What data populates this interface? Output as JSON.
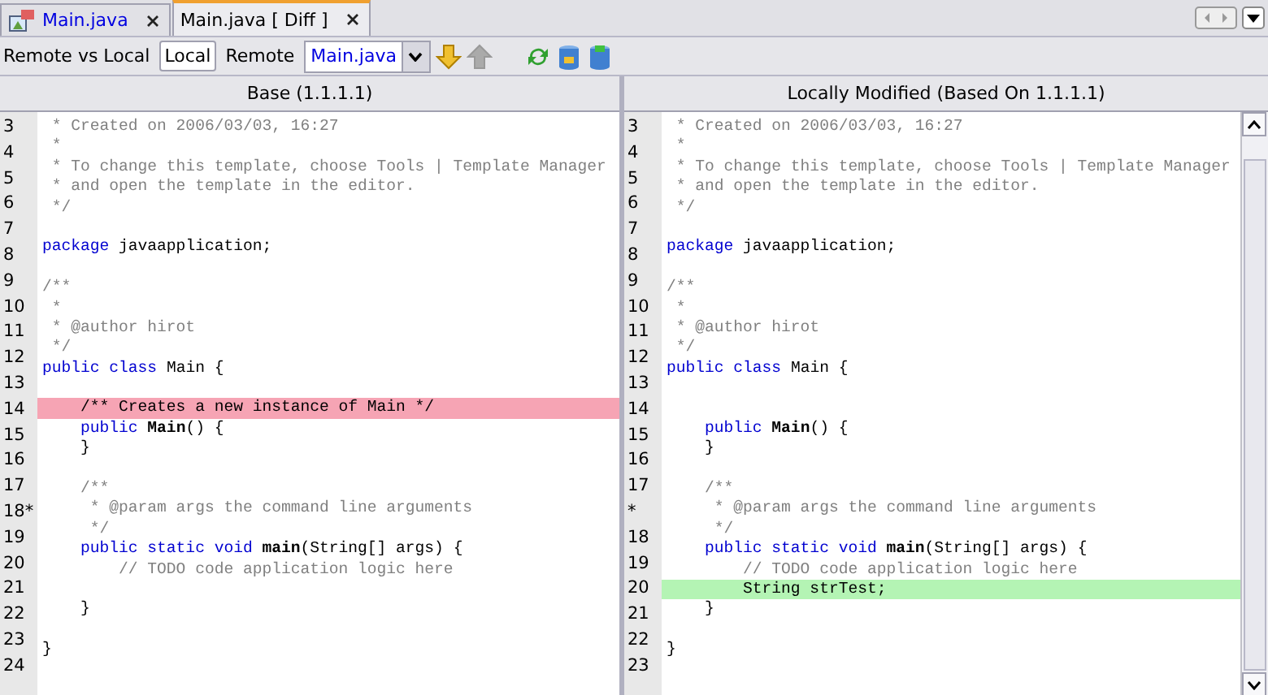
{
  "tabs": [
    {
      "label": "Main.java",
      "selected": false
    },
    {
      "label": "Main.java [ Diff ]",
      "selected": true
    }
  ],
  "toolbar": {
    "label": "Remote vs Local",
    "modes": [
      {
        "label": "Local",
        "selected": true
      },
      {
        "label": "Remote",
        "selected": false
      }
    ],
    "file_combo": {
      "value": "Main.java"
    },
    "next_diff": {
      "disabled": false
    },
    "prev_diff": {
      "disabled": true
    }
  },
  "panes": [
    {
      "title": "Base (1.1.1.1)",
      "gutter": [
        "3",
        "4",
        "5",
        "6",
        "7",
        "8",
        "9",
        "10",
        "11",
        "12",
        "13",
        "14",
        "15",
        "16",
        "17",
        "18*",
        "19",
        "20",
        "21",
        "22",
        "23",
        "24"
      ],
      "lines": [
        {
          "kind": "context",
          "segments": [
            {
              "kind": "comment",
              "text": " * Created on 2006/03/03, 16:27"
            }
          ]
        },
        {
          "kind": "context",
          "segments": [
            {
              "kind": "comment",
              "text": " *"
            }
          ]
        },
        {
          "kind": "context",
          "segments": [
            {
              "kind": "comment",
              "text": " * To change this template, choose Tools | Template Manager"
            }
          ]
        },
        {
          "kind": "context",
          "segments": [
            {
              "kind": "comment",
              "text": " * and open the template in the editor."
            }
          ]
        },
        {
          "kind": "context",
          "segments": [
            {
              "kind": "comment",
              "text": " */"
            }
          ]
        },
        {
          "kind": "blank"
        },
        {
          "kind": "context",
          "segments": [
            {
              "kind": "keyword",
              "text": "package"
            },
            {
              "kind": "plain",
              "text": " javaapplication;"
            }
          ]
        },
        {
          "kind": "blank"
        },
        {
          "kind": "context",
          "segments": [
            {
              "kind": "comment",
              "text": "/**"
            }
          ]
        },
        {
          "kind": "context",
          "segments": [
            {
              "kind": "comment",
              "text": " *"
            }
          ]
        },
        {
          "kind": "context",
          "segments": [
            {
              "kind": "comment",
              "text": " * @author hirot"
            }
          ]
        },
        {
          "kind": "context",
          "segments": [
            {
              "kind": "comment",
              "text": " */"
            }
          ]
        },
        {
          "kind": "context",
          "segments": [
            {
              "kind": "keyword",
              "text": "public class"
            },
            {
              "kind": "plain",
              "text": " Main {"
            }
          ]
        },
        {
          "kind": "blank"
        },
        {
          "kind": "deleted",
          "segments": [
            {
              "kind": "plain",
              "text": "    /** Creates a new instance of Main */"
            }
          ]
        },
        {
          "kind": "context",
          "segments": [
            {
              "kind": "keyword",
              "text": "    public"
            },
            {
              "kind": "method",
              "text": " Main"
            },
            {
              "kind": "plain",
              "text": "() {"
            }
          ]
        },
        {
          "kind": "context",
          "segments": [
            {
              "kind": "plain",
              "text": "    }"
            }
          ]
        },
        {
          "kind": "blank"
        },
        {
          "kind": "context",
          "segments": [
            {
              "kind": "comment",
              "text": "    /**"
            }
          ]
        },
        {
          "kind": "context",
          "segments": [
            {
              "kind": "comment",
              "text": "     * @param args the command line arguments"
            }
          ]
        },
        {
          "kind": "context",
          "segments": [
            {
              "kind": "comment",
              "text": "     */"
            }
          ]
        },
        {
          "kind": "context",
          "segments": [
            {
              "kind": "keyword",
              "text": "    public static void"
            },
            {
              "kind": "method",
              "text": " main"
            },
            {
              "kind": "plain",
              "text": "(String[] args) {"
            }
          ]
        },
        {
          "kind": "context",
          "segments": [
            {
              "kind": "comment",
              "text": "        // TODO code application logic here"
            }
          ]
        },
        {
          "kind": "blank"
        },
        {
          "kind": "context",
          "segments": [
            {
              "kind": "plain",
              "text": "    }"
            }
          ]
        },
        {
          "kind": "blank"
        },
        {
          "kind": "context",
          "segments": [
            {
              "kind": "plain",
              "text": "}"
            }
          ]
        },
        {
          "kind": "blank"
        }
      ]
    },
    {
      "title": "Locally Modified (Based On 1.1.1.1)",
      "gutter": [
        "3",
        "4",
        "5",
        "6",
        "7",
        "8",
        "9",
        "10",
        "11",
        "12",
        "13",
        "14",
        "15",
        "16",
        "17",
        "*",
        "18",
        "19",
        "20",
        "21",
        "22",
        "23"
      ],
      "lines": [
        {
          "kind": "context",
          "segments": [
            {
              "kind": "comment",
              "text": " * Created on 2006/03/03, 16:27"
            }
          ]
        },
        {
          "kind": "context",
          "segments": [
            {
              "kind": "comment",
              "text": " *"
            }
          ]
        },
        {
          "kind": "context",
          "segments": [
            {
              "kind": "comment",
              "text": " * To change this template, choose Tools | Template Manager"
            }
          ]
        },
        {
          "kind": "context",
          "segments": [
            {
              "kind": "comment",
              "text": " * and open the template in the editor."
            }
          ]
        },
        {
          "kind": "context",
          "segments": [
            {
              "kind": "comment",
              "text": " */"
            }
          ]
        },
        {
          "kind": "blank"
        },
        {
          "kind": "context",
          "segments": [
            {
              "kind": "keyword",
              "text": "package"
            },
            {
              "kind": "plain",
              "text": " javaapplication;"
            }
          ]
        },
        {
          "kind": "blank"
        },
        {
          "kind": "context",
          "segments": [
            {
              "kind": "comment",
              "text": "/**"
            }
          ]
        },
        {
          "kind": "context",
          "segments": [
            {
              "kind": "comment",
              "text": " *"
            }
          ]
        },
        {
          "kind": "context",
          "segments": [
            {
              "kind": "comment",
              "text": " * @author hirot"
            }
          ]
        },
        {
          "kind": "context",
          "segments": [
            {
              "kind": "comment",
              "text": " */"
            }
          ]
        },
        {
          "kind": "context",
          "segments": [
            {
              "kind": "keyword",
              "text": "public class"
            },
            {
              "kind": "plain",
              "text": " Main {"
            }
          ]
        },
        {
          "kind": "blank"
        },
        {
          "kind": "blank"
        },
        {
          "kind": "context",
          "segments": [
            {
              "kind": "keyword",
              "text": "    public"
            },
            {
              "kind": "method",
              "text": " Main"
            },
            {
              "kind": "plain",
              "text": "() {"
            }
          ]
        },
        {
          "kind": "context",
          "segments": [
            {
              "kind": "plain",
              "text": "    }"
            }
          ]
        },
        {
          "kind": "blank"
        },
        {
          "kind": "context",
          "segments": [
            {
              "kind": "comment",
              "text": "    /**"
            }
          ]
        },
        {
          "kind": "context",
          "segments": [
            {
              "kind": "comment",
              "text": "     * @param args the command line arguments"
            }
          ]
        },
        {
          "kind": "context",
          "segments": [
            {
              "kind": "comment",
              "text": "     */"
            }
          ]
        },
        {
          "kind": "context",
          "segments": [
            {
              "kind": "keyword",
              "text": "    public static void"
            },
            {
              "kind": "method",
              "text": " main"
            },
            {
              "kind": "plain",
              "text": "(String[] args) {"
            }
          ]
        },
        {
          "kind": "context",
          "segments": [
            {
              "kind": "comment",
              "text": "        // TODO code application logic here"
            }
          ]
        },
        {
          "kind": "added",
          "segments": [
            {
              "kind": "plain",
              "text": "        String strTest;"
            }
          ]
        },
        {
          "kind": "context",
          "segments": [
            {
              "kind": "plain",
              "text": "    }"
            }
          ]
        },
        {
          "kind": "blank"
        },
        {
          "kind": "context",
          "segments": [
            {
              "kind": "plain",
              "text": "}"
            }
          ]
        },
        {
          "kind": "blank"
        }
      ]
    }
  ]
}
